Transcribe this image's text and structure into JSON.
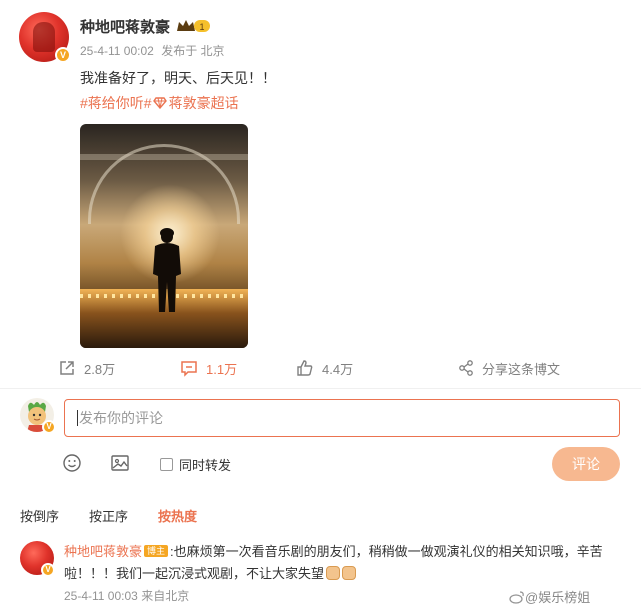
{
  "post": {
    "username": "种地吧蒋敦豪",
    "level_badge": "1",
    "verified_badge": "V",
    "date": "25-4-11 00:02",
    "location": "发布于 北京",
    "text": "我准备好了，明天、后天见！！",
    "tag1": "#蒋给你听#",
    "tag2": "蒋敦豪超话"
  },
  "actions": {
    "repost_count": "2.8万",
    "comment_count": "1.1万",
    "like_count": "4.4万",
    "share_label": "分享这条博文"
  },
  "composer": {
    "placeholder": "发布你的评论",
    "forward_label": "同时转发",
    "submit_label": "评论"
  },
  "sort": {
    "options": [
      "按倒序",
      "按正序",
      "按热度"
    ],
    "active": "按热度"
  },
  "comment": {
    "author": "种地吧蒋敦豪",
    "badge": "博主",
    "text": ":也麻烦第一次看音乐剧的朋友们，稍稍做一做观演礼仪的相关知识哦，辛苦啦！！！我们一起沉浸式观剧，不让大家失望",
    "date": "25-4-11 00:03",
    "source": "来自北京"
  },
  "watermark": "@娱乐榜姐",
  "colors": {
    "accent": "#eb7350",
    "submit_disabled": "#f7b890",
    "meta_gray": "#939393"
  }
}
